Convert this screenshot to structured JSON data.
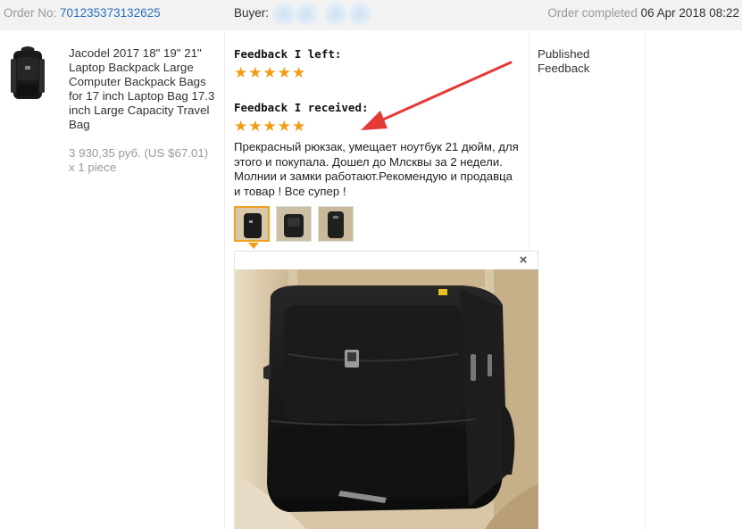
{
  "header": {
    "order_label": "Order No:",
    "order_number": "701235373132625",
    "buyer_label": "Buyer:",
    "completed_label": "Order completed",
    "completed_date": "06 Apr 2018 08:22"
  },
  "product": {
    "title": "Jacodel 2017 18\" 19\" 21\" Laptop Backpack Large Computer Backpack Bags for 17 inch Laptop Bag 17.3 inch Large Capacity Travel Bag",
    "price": "3 930,35 руб. (US $67.01)",
    "quantity": "x 1 piece"
  },
  "feedback": {
    "left_label": "Feedback I left:",
    "left_stars": 5,
    "received_label": "Feedback I received:",
    "received_stars": 5,
    "comment": "Прекрасный рюкзак, умещает ноутбук 21 дюйм, для этого и покупала. Дошел до Млсквы за 2 недели. Молнии и замки работают.Рекомендую и продавца и товар ! Все супер !",
    "photos": [
      "photo-1",
      "photo-2",
      "photo-3"
    ],
    "selected_photo": 0
  },
  "status": {
    "line1": "Published",
    "line2": "Feedback"
  },
  "viewer": {
    "close_symbol": "×"
  },
  "colors": {
    "link": "#2a6ebb",
    "star": "#f39c12",
    "thumb_active": "#f0a020",
    "arrow": "#e53935"
  },
  "icons": {
    "star": "star-icon",
    "close": "close-icon",
    "arrow": "red-arrow-annotation"
  }
}
